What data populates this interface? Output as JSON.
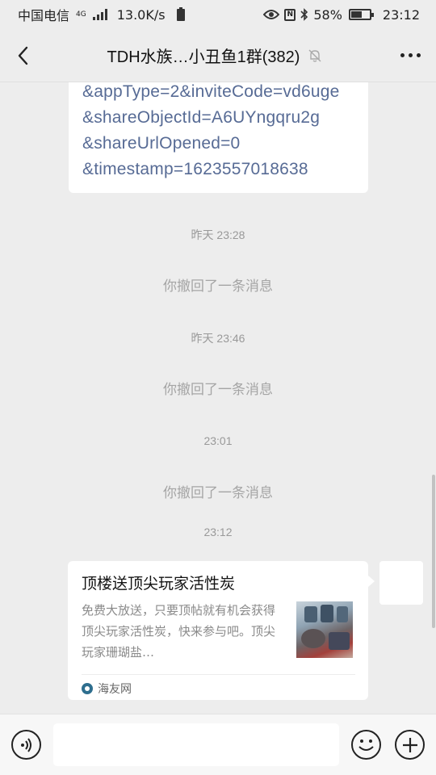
{
  "status_bar": {
    "carrier": "中国电信",
    "network_type": "4G",
    "net_speed": "13.0K/s",
    "battery_percent": "58%",
    "battery_level": 0.58,
    "time": "23:12"
  },
  "header": {
    "title": "TDH水族…小丑鱼1群(382)",
    "muted_icon": "bell-muted-icon"
  },
  "messages": {
    "link_lines": [
      "&appType=2&inviteCode=vd6uge",
      "&shareObjectId=A6UYngqru2g",
      "&shareUrlOpened=0",
      "&timestamp=1623557018638"
    ],
    "events": [
      {
        "time": "昨天 23:28",
        "notice": "你撤回了一条消息"
      },
      {
        "time": "昨天 23:46",
        "notice": "你撤回了一条消息"
      },
      {
        "time": "23:01",
        "notice": "你撤回了一条消息"
      },
      {
        "time": "23:12"
      }
    ],
    "card": {
      "title": "顶楼送顶尖玩家活性炭",
      "description": "免费大放送，只要顶帖就有机会获得顶尖玩家活性炭，快来参与吧。顶尖玩家珊瑚盐…",
      "source": "海友网"
    }
  },
  "input_bar": {
    "voice_icon": "voice-icon",
    "emoji_icon": "emoji-icon",
    "plus_icon": "plus-icon"
  },
  "colors": {
    "background": "#ededed",
    "link": "#576b95",
    "system_text": "#a5a5a5"
  }
}
